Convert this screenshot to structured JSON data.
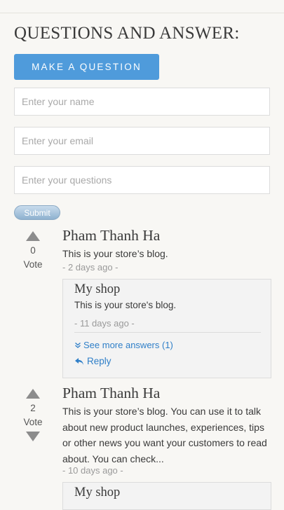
{
  "qa": {
    "title": "QUESTIONS AND ANSWER:",
    "make_question_label": "MAKE A QUESTION"
  },
  "form": {
    "name_placeholder": "Enter your name",
    "email_placeholder": "Enter your email",
    "questions_placeholder": "Enter your questions",
    "submit_label": "Submit"
  },
  "questions": [
    {
      "votes": "0",
      "vote_label": "Vote",
      "author": "Pham Thanh Ha",
      "body": "This is your store’s blog.",
      "date": "- 2 days ago -",
      "answer": {
        "author": "My shop",
        "body": "This is your store's blog.",
        "date": "- 11 days ago -",
        "see_more_label": "See more answers (1)",
        "reply_label": "Reply"
      }
    },
    {
      "votes": "2",
      "vote_label": "Vote",
      "author": "Pham Thanh Ha",
      "body": "This is your store’s blog. You can use it to talk about new product launches, experiences, tips or other news you want your customers to read about. You can check...",
      "date": "- 10 days ago -",
      "answer": {
        "author": "My shop"
      }
    }
  ],
  "colors": {
    "accent": "#4f9bdb",
    "link": "#2f7fc8",
    "background": "#f8f7f4"
  }
}
